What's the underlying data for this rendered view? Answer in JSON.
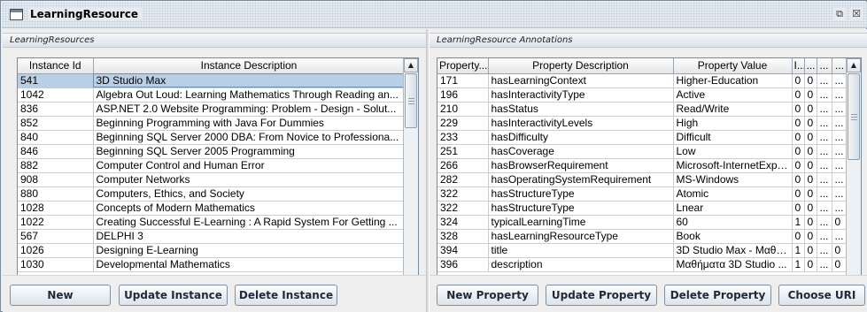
{
  "window": {
    "title": "LearningResource",
    "restore_glyph": "⧉",
    "close_glyph": "☒"
  },
  "left_panel": {
    "header": "LearningResources",
    "columns": [
      "Instance Id",
      "Instance Description"
    ],
    "rows": [
      {
        "id": "541",
        "desc": "3D Studio Max",
        "selected": true
      },
      {
        "id": "1042",
        "desc": "Algebra Out Loud: Learning Mathematics Through Reading an..."
      },
      {
        "id": "836",
        "desc": "ASP.NET 2.0 Website Programming: Problem - Design - Solut..."
      },
      {
        "id": "852",
        "desc": "Beginning Programming with Java For Dummies"
      },
      {
        "id": "840",
        "desc": "Beginning SQL Server 2000 DBA: From Novice to Professiona..."
      },
      {
        "id": "846",
        "desc": "Beginning SQL Server 2005 Programming"
      },
      {
        "id": "882",
        "desc": "Computer Control and Human Error"
      },
      {
        "id": "908",
        "desc": "Computer Networks"
      },
      {
        "id": "880",
        "desc": "Computers, Ethics, and Society"
      },
      {
        "id": "1028",
        "desc": "Concepts of Modern Mathematics"
      },
      {
        "id": "1022",
        "desc": "Creating Successful E-Learning : A Rapid System For Getting ..."
      },
      {
        "id": "567",
        "desc": "DELPHI 3"
      },
      {
        "id": "1026",
        "desc": "Designing E-Learning"
      },
      {
        "id": "1030",
        "desc": "Developmental Mathematics"
      }
    ],
    "buttons": {
      "new": "New",
      "update": "Update Instance",
      "delete": "Delete Instance"
    }
  },
  "right_panel": {
    "header": "LearningResource Annotations",
    "columns": [
      "Property...",
      "Property Description",
      "Property Value",
      "I...",
      "...",
      "...",
      "..."
    ],
    "rows": [
      {
        "id": "171",
        "desc": "hasLearningContext",
        "value": "Higher-Education",
        "c1": "0",
        "c2": "0",
        "c3": "...",
        "c4": "..."
      },
      {
        "id": "196",
        "desc": "hasInteractivityType",
        "value": "Active",
        "c1": "0",
        "c2": "0",
        "c3": "...",
        "c4": "..."
      },
      {
        "id": "210",
        "desc": "hasStatus",
        "value": "Read/Write",
        "c1": "0",
        "c2": "0",
        "c3": "...",
        "c4": "..."
      },
      {
        "id": "229",
        "desc": "hasInteractivityLevels",
        "value": "High",
        "c1": "0",
        "c2": "0",
        "c3": "...",
        "c4": "..."
      },
      {
        "id": "233",
        "desc": "hasDifficulty",
        "value": "Difficult",
        "c1": "0",
        "c2": "0",
        "c3": "...",
        "c4": "..."
      },
      {
        "id": "251",
        "desc": "hasCoverage",
        "value": "Low",
        "c1": "0",
        "c2": "0",
        "c3": "...",
        "c4": "..."
      },
      {
        "id": "266",
        "desc": "hasBrowserRequirement",
        "value": "Microsoft-InternetExplo...",
        "c1": "0",
        "c2": "0",
        "c3": "...",
        "c4": "..."
      },
      {
        "id": "282",
        "desc": "hasOperatingSystemRequirement",
        "value": "MS-Windows",
        "c1": "0",
        "c2": "0",
        "c3": "...",
        "c4": "..."
      },
      {
        "id": "322",
        "desc": "hasStructureType",
        "value": "Atomic",
        "c1": "0",
        "c2": "0",
        "c3": "...",
        "c4": "..."
      },
      {
        "id": "322",
        "desc": "hasStructureType",
        "value": "Lnear",
        "c1": "0",
        "c2": "0",
        "c3": "...",
        "c4": "..."
      },
      {
        "id": "324",
        "desc": "typicalLearningTime",
        "value": "60",
        "c1": "1",
        "c2": "0",
        "c3": "...",
        "c4": "0"
      },
      {
        "id": "328",
        "desc": "hasLearningResourceType",
        "value": "Book",
        "c1": "0",
        "c2": "0",
        "c3": "...",
        "c4": "..."
      },
      {
        "id": "394",
        "desc": "title",
        "value": "3D Studio Max - Μαθή...",
        "c1": "1",
        "c2": "0",
        "c3": "...",
        "c4": "0"
      },
      {
        "id": "396",
        "desc": "description",
        "value": "Μαθήματα 3D Studio ...",
        "c1": "1",
        "c2": "0",
        "c3": "...",
        "c4": "0"
      }
    ],
    "buttons": {
      "new": "New Property",
      "update": "Update Property",
      "delete": "Delete Property",
      "choose": "Choose URI"
    }
  },
  "colors": {
    "selection": "#b8cfe5",
    "border": "#7a8a99",
    "panel_bg": "#eeeeee"
  }
}
